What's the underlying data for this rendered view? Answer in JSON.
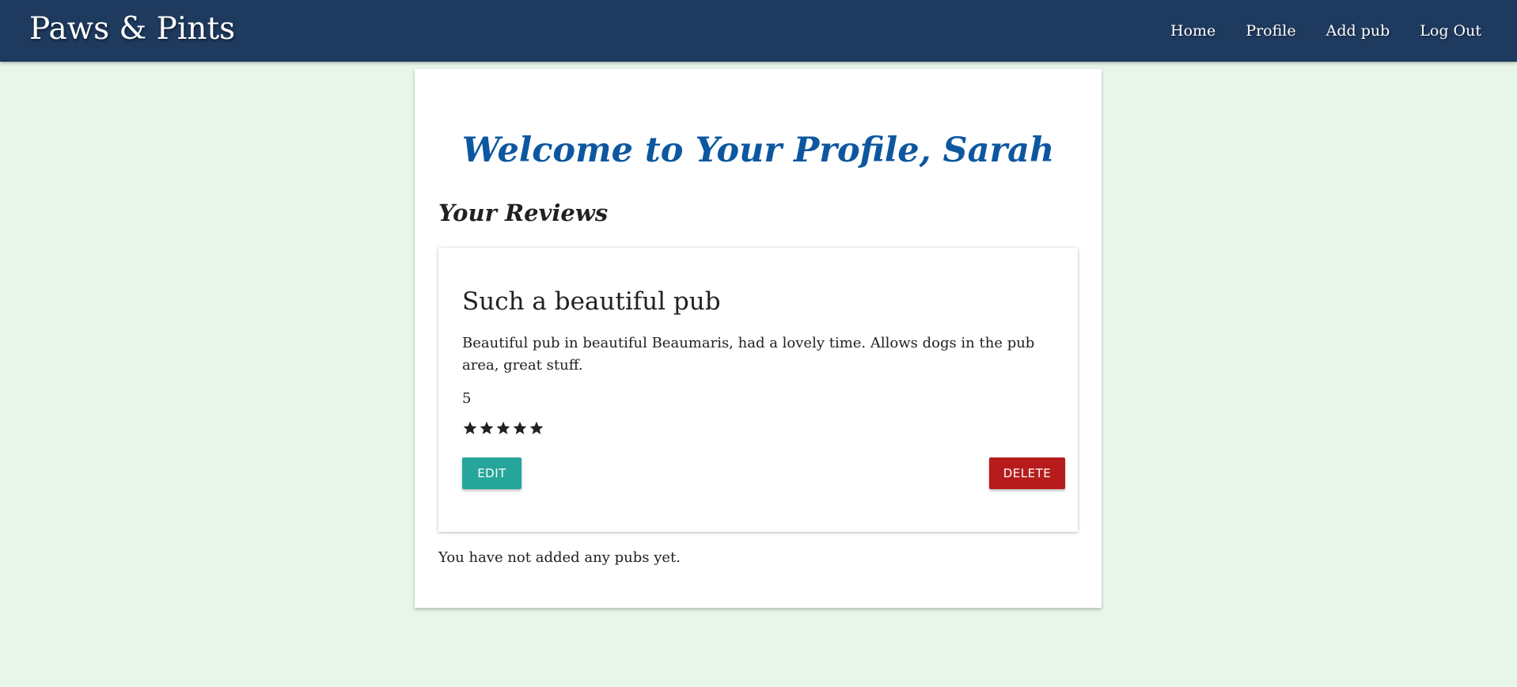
{
  "navbar": {
    "brand": "Paws & Pints",
    "links": [
      {
        "label": "Home"
      },
      {
        "label": "Profile"
      },
      {
        "label": "Add pub"
      },
      {
        "label": "Log Out"
      }
    ],
    "background_color": "#1e3a5f"
  },
  "profile": {
    "welcome_heading": "Welcome to Your Profile, Sarah",
    "reviews_heading": "Your Reviews",
    "heading_color": "#0d57a0"
  },
  "reviews": [
    {
      "title": "Such a beautiful pub",
      "body": "Beautiful pub in beautiful Beaumaris, had a lovely time. Allows dogs in the pub area, great stuff.",
      "rating": "5",
      "stars_filled": 5,
      "stars_total": 5,
      "edit_label": "EDIT",
      "delete_label": "DELETE"
    }
  ],
  "pubs": {
    "empty_message": "You have not added any pubs yet."
  },
  "colors": {
    "page_background": "#e8f5e9",
    "edit_button": "#26a69a",
    "delete_button": "#b71c1c"
  },
  "icons": {
    "star": "star-icon"
  }
}
